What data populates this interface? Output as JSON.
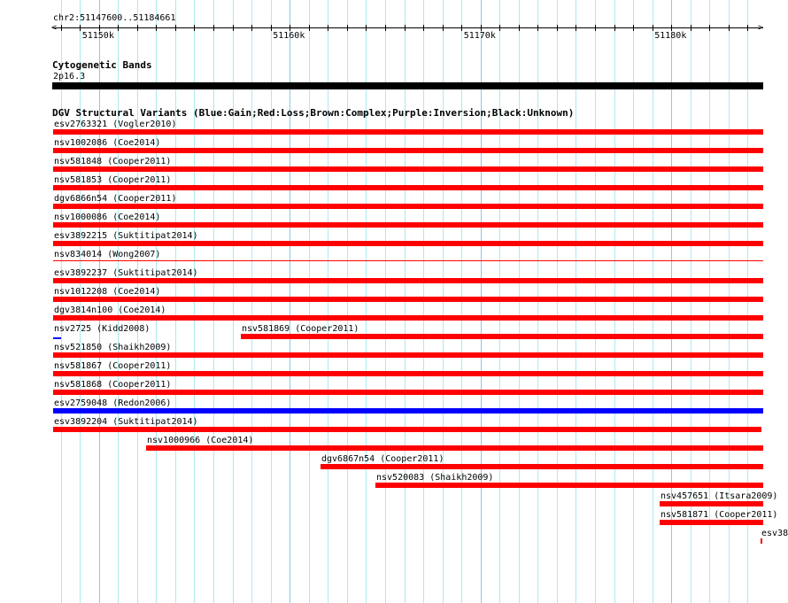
{
  "ruler": {
    "location": "chr2:51147600..51184661",
    "start": 51147600,
    "end": 51184800,
    "tick_labels": [
      {
        "pos": 51150000,
        "label": "51150k"
      },
      {
        "pos": 51160000,
        "label": "51160k"
      },
      {
        "pos": 51170000,
        "label": "51170k"
      },
      {
        "pos": 51180000,
        "label": "51180k"
      }
    ]
  },
  "cyto": {
    "title": "Cytogenetic Bands",
    "band": "2p16.3",
    "color": "#000000"
  },
  "dgv": {
    "title": "DGV Structural Variants (Blue:Gain;Red:Loss;Brown:Complex;Purple:Inversion;Black:Unknown)",
    "colors": {
      "loss": "#ff0000",
      "gain": "#0000ff"
    },
    "features": [
      {
        "row": 0,
        "label": "esv2763321 (Vogler2010)",
        "start": 51147600,
        "end": 51184800,
        "type": "loss"
      },
      {
        "row": 1,
        "label": "nsv1002086 (Coe2014)",
        "start": 51147600,
        "end": 51184800,
        "type": "loss"
      },
      {
        "row": 2,
        "label": "nsv581848 (Cooper2011)",
        "start": 51147600,
        "end": 51184800,
        "type": "loss"
      },
      {
        "row": 3,
        "label": "nsv581853 (Cooper2011)",
        "start": 51147600,
        "end": 51184800,
        "type": "loss"
      },
      {
        "row": 4,
        "label": "dgv6866n54 (Cooper2011)",
        "start": 51147600,
        "end": 51184800,
        "type": "loss"
      },
      {
        "row": 5,
        "label": "nsv1000086 (Coe2014)",
        "start": 51147600,
        "end": 51184800,
        "type": "loss"
      },
      {
        "row": 6,
        "label": "esv3892215 (Suktitipat2014)",
        "start": 51147600,
        "end": 51184800,
        "type": "loss"
      },
      {
        "row": 7,
        "label": "nsv834014 (Wong2007)",
        "start": 51147600,
        "end": 51184800,
        "type": "loss",
        "thin": true
      },
      {
        "row": 8,
        "label": "esv3892237 (Suktitipat2014)",
        "start": 51147600,
        "end": 51184800,
        "type": "loss"
      },
      {
        "row": 9,
        "label": "nsv1012208 (Coe2014)",
        "start": 51147600,
        "end": 51184800,
        "type": "loss"
      },
      {
        "row": 10,
        "label": "dgv3814n100 (Coe2014)",
        "start": 51147600,
        "end": 51184800,
        "type": "loss"
      },
      {
        "row": 11,
        "label": "nsv2725 (Kidd2008)",
        "start": 51147600,
        "end": 51148000,
        "type": "gain",
        "thin": true
      },
      {
        "row": 11,
        "label": "nsv581869 (Cooper2011)",
        "start": 51157450,
        "end": 51184800,
        "type": "loss"
      },
      {
        "row": 12,
        "label": "nsv521850 (Shaikh2009)",
        "start": 51147600,
        "end": 51184800,
        "type": "loss"
      },
      {
        "row": 13,
        "label": "nsv581867 (Cooper2011)",
        "start": 51147600,
        "end": 51184800,
        "type": "loss"
      },
      {
        "row": 14,
        "label": "nsv581868 (Cooper2011)",
        "start": 51147600,
        "end": 51184800,
        "type": "loss"
      },
      {
        "row": 15,
        "label": "esv2759048 (Redon2006)",
        "start": 51147600,
        "end": 51184800,
        "type": "gain"
      },
      {
        "row": 16,
        "label": "esv3892204 (Suktitipat2014)",
        "start": 51147600,
        "end": 51184700,
        "type": "loss"
      },
      {
        "row": 17,
        "label": "nsv1000966 (Coe2014)",
        "start": 51152450,
        "end": 51184800,
        "type": "loss"
      },
      {
        "row": 18,
        "label": "dgv6867n54 (Cooper2011)",
        "start": 51161600,
        "end": 51184800,
        "type": "loss"
      },
      {
        "row": 19,
        "label": "nsv520083 (Shaikh2009)",
        "start": 51164470,
        "end": 51184800,
        "type": "loss"
      },
      {
        "row": 20,
        "label": "nsv457651 (Itsara2009)",
        "start": 51179400,
        "end": 51184800,
        "type": "loss"
      },
      {
        "row": 21,
        "label": "nsv581871 (Cooper2011)",
        "start": 51179400,
        "end": 51184800,
        "type": "loss"
      },
      {
        "row": 22,
        "label": "esv38",
        "start": 51184680,
        "end": 51184780,
        "type": "loss"
      }
    ]
  }
}
